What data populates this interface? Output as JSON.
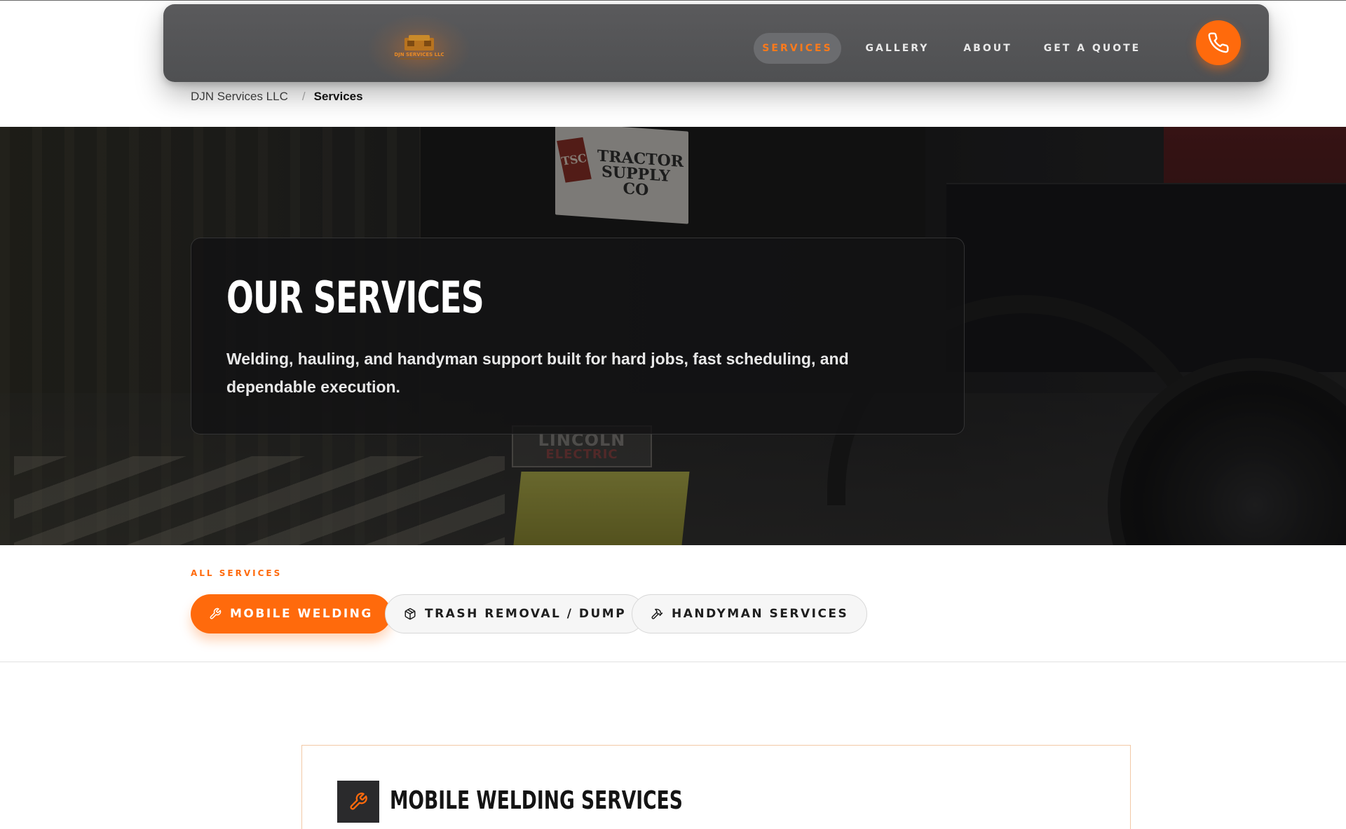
{
  "header": {
    "logo_text": "DJN SERVICES LLC",
    "nav": [
      {
        "label": "SERVICES",
        "active": true
      },
      {
        "label": "GALLERY",
        "active": false
      },
      {
        "label": "ABOUT",
        "active": false
      },
      {
        "label": "GET A QUOTE",
        "active": false
      }
    ],
    "call_icon": "phone-icon",
    "accent_color": "#ff6a0c"
  },
  "breadcrumb": {
    "home": "DJN Services LLC",
    "separator": "/",
    "current": "Services"
  },
  "hero": {
    "title": "OUR SERVICES",
    "subtitle": "Welding, hauling, and handyman support built for hard jobs, fast scheduling, and dependable execution.",
    "bg_sign_1": "TRACTOR SUPPLY CO",
    "bg_sign_1_badge": "TSC",
    "bg_sign_2": "LINCOLN",
    "bg_sign_2_sub": "ELECTRIC"
  },
  "services": {
    "label": "ALL SERVICES",
    "tabs": [
      {
        "label": "MOBILE WELDING",
        "icon": "wrench-icon",
        "active": true
      },
      {
        "label": "TRASH REMOVAL / DUMP",
        "icon": "box-icon",
        "active": false
      },
      {
        "label": "HANDYMAN SERVICES",
        "icon": "hammer-icon",
        "active": false
      }
    ]
  },
  "detail": {
    "title": "MOBILE WELDING SERVICES",
    "icon": "wrench-icon"
  }
}
